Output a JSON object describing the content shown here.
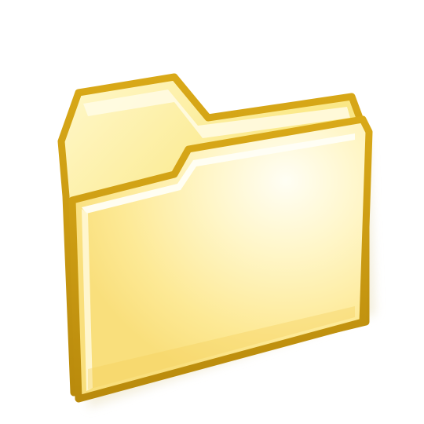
{
  "icon": {
    "name": "folder-icon",
    "state": "closed",
    "colors": {
      "outline": "#c99a12",
      "outline_dark": "#a87a0a",
      "back_panel": "#fbea8a",
      "back_highlight": "#fff7c4",
      "front_panel": "#fdeea0",
      "front_glow": "#fffdf0",
      "front_edge_light": "#fffbe0",
      "shadow": "#e9e2c8",
      "background": "#ffffff"
    }
  }
}
